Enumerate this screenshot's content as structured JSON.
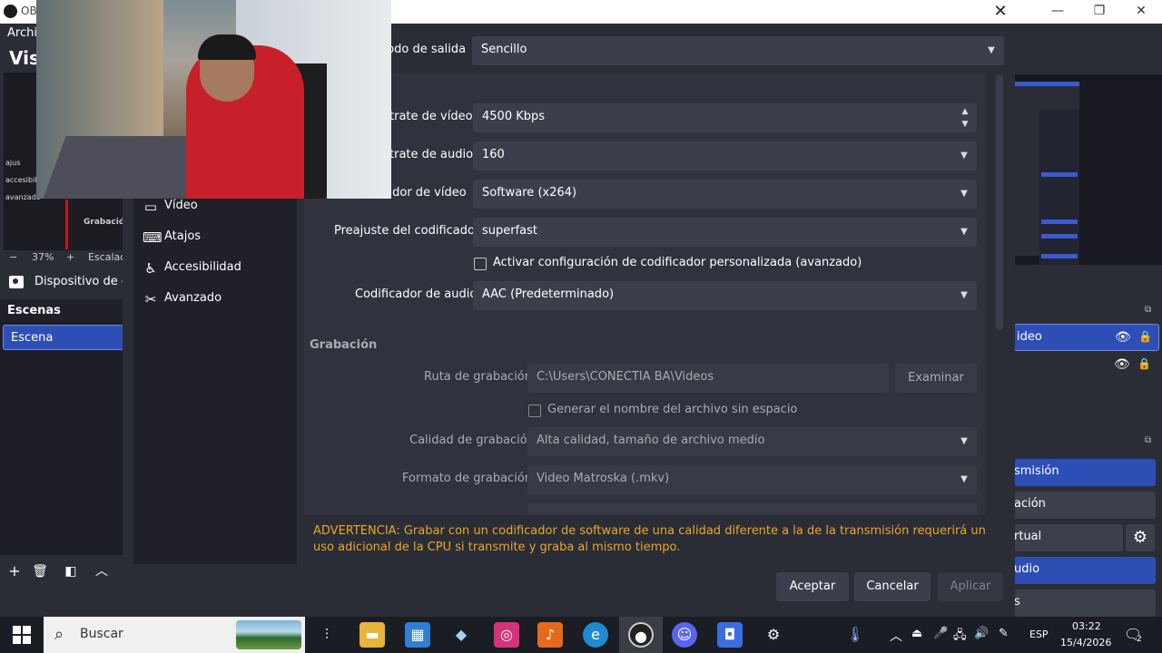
{
  "main_window": {
    "title": "OB",
    "menu_file": "Archiv",
    "view_label": "Vist",
    "zoom": "37%",
    "zoom_minus": "−",
    "zoom_plus": "+",
    "scale_label": "Escalad",
    "preview_small_texts": [
      "ajus",
      "accesibilidad",
      "avanzado"
    ],
    "preview_grab_label": "Grabación",
    "source_label": "Dispositivo de ca",
    "scenes_header": "Escenas",
    "scene_item": "Escena",
    "right_source_selected": "ideo",
    "controls": {
      "streaming": "smisión",
      "recording": "ación",
      "virtual_cam": "rtual",
      "studio": "udio",
      "exit": "s"
    }
  },
  "settings": {
    "categories": [
      {
        "label": "Vídeo",
        "icon": "monitor-icon"
      },
      {
        "label": "Atajos",
        "icon": "keyboard-icon"
      },
      {
        "label": "Accesibilidad",
        "icon": "accessibility-icon"
      },
      {
        "label": "Avanzado",
        "icon": "wrench-icon"
      }
    ],
    "output_mode_label": "Modo de salida",
    "output_mode_value": "Sencillo",
    "streaming": {
      "video_bitrate_label": "trate de vídeo",
      "video_bitrate_value": "4500 Kbps",
      "audio_bitrate_label": "trate de audio",
      "audio_bitrate_value": "160",
      "video_encoder_label": "cador de vídeo",
      "video_encoder_value": "Software (x264)",
      "encoder_preset_label": "Preajuste del codificador",
      "encoder_preset_value": "superfast",
      "custom_encoder_checkbox": "Activar configuración de codificador personalizada (avanzado)",
      "audio_encoder_label": "Codificador de audio",
      "audio_encoder_value": "AAC (Predeterminado)"
    },
    "recording": {
      "section_title": "Grabación",
      "path_label": "Ruta de grabación",
      "path_value": "C:\\Users\\CONECTIA BA\\Videos",
      "browse_button": "Examinar",
      "no_space_checkbox": "Generar el nombre del archivo sin espacio",
      "quality_label": "Calidad de grabación",
      "quality_value": "Alta calidad, tamaño de archivo medio",
      "format_label": "Formato de grabación",
      "format_value": "Video Matroska (.mkv)"
    },
    "warning": "ADVERTENCIA: Grabar con un codificador de software de una calidad diferente a la de la transmisión requerirá un uso adicional de la CPU si transmite y graba al mismo tiempo.",
    "buttons": {
      "accept": "Aceptar",
      "cancel": "Cancelar",
      "apply": "Aplicar"
    },
    "warning_color": "#e8a72b"
  },
  "taskbar": {
    "search_placeholder": "Buscar",
    "language": "ESP",
    "time": "03:22",
    "date": "15/4/2026",
    "notifications": "2"
  },
  "colors": {
    "accent": "#2d4fb5",
    "panel": "#2b2d36"
  }
}
